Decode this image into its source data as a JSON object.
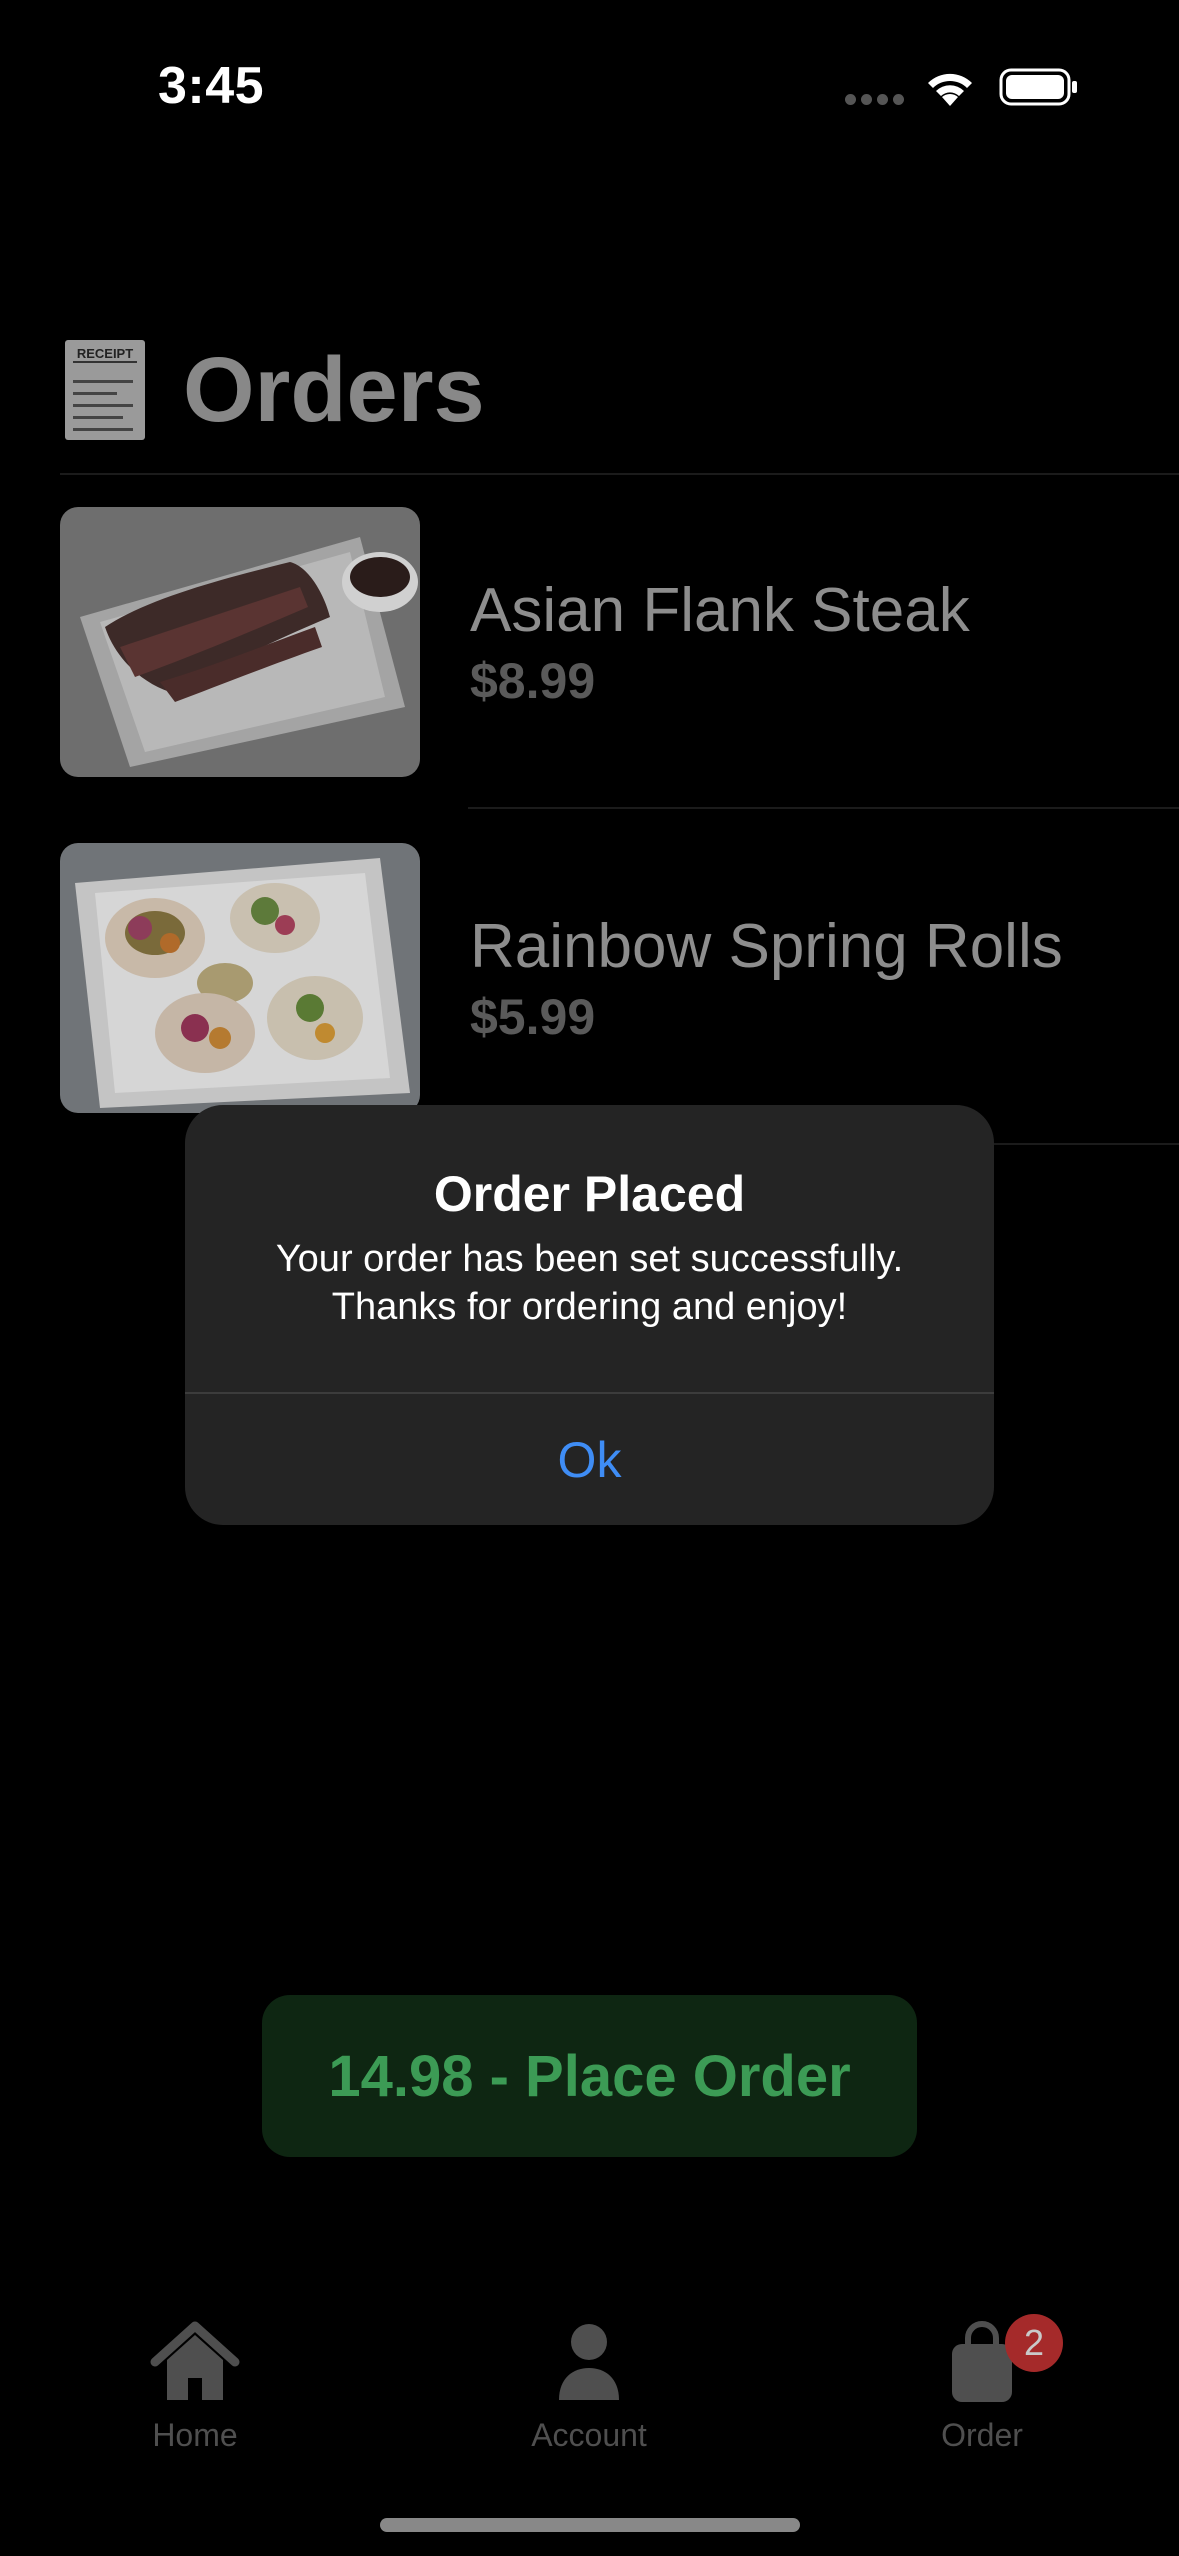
{
  "status_bar": {
    "time": "3:45",
    "icons": [
      "signal-dots",
      "wifi-icon",
      "battery-icon"
    ]
  },
  "header": {
    "icon": "receipt-icon",
    "icon_text": "RECEIPT",
    "title": "Orders"
  },
  "orders": [
    {
      "name": "Asian Flank Steak",
      "price": "$8.99",
      "image": "flank-steak-photo"
    },
    {
      "name": "Rainbow Spring Rolls",
      "price": "$5.99",
      "image": "spring-rolls-photo"
    }
  ],
  "alert": {
    "title": "Order Placed",
    "message": "Your order has been set successfully.\nThanks for ordering and enjoy!",
    "ok_label": "Ok"
  },
  "place_order": {
    "label": "14.98 - Place Order"
  },
  "tab_bar": {
    "items": [
      {
        "label": "Home",
        "icon": "house-icon"
      },
      {
        "label": "Account",
        "icon": "person-icon"
      },
      {
        "label": "Order",
        "icon": "bag-icon"
      }
    ],
    "order_badge": "2"
  },
  "colors": {
    "accent_blue": "#3f8df5",
    "place_order_text": "#3c9b55",
    "badge": "#a52a2a"
  }
}
